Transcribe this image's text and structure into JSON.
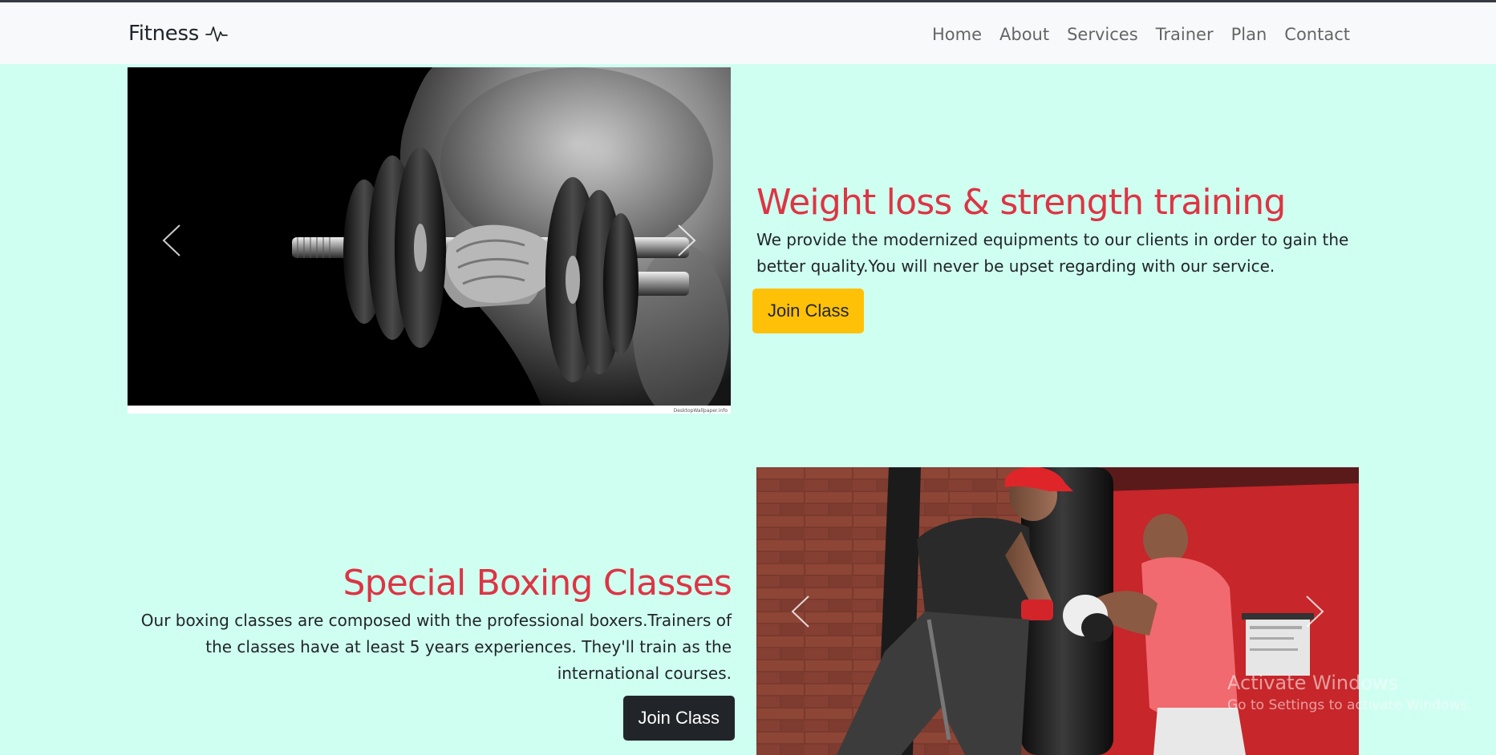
{
  "navbar": {
    "brand": "Fitness",
    "links": [
      "Home",
      "About",
      "Services",
      "Trainer",
      "Plan",
      "Contact"
    ]
  },
  "section1": {
    "heading": "Weight loss & strength training",
    "text": "We provide the modernized equipments to our clients in order to gain the better quality.You will never be upset regarding with our service.",
    "button": "Join Class",
    "image_credit": "DesktopWallpaper.info"
  },
  "section2": {
    "heading": "Special Boxing Classes",
    "text": "Our boxing classes are composed with the professional boxers.Trainers of the classes have at least 5 years experiences. They'll train as the international courses.",
    "button": "Join Class"
  },
  "watermark": {
    "title": "Activate Windows",
    "subtitle": "Go to Settings to activate Windows."
  },
  "colors": {
    "page_bg": "#cffff0",
    "navbar_bg": "#f8f9fa",
    "heading": "#dc3545",
    "btn_warning": "#ffc107",
    "btn_dark": "#212529"
  },
  "icons": {
    "brand": "activity-pulse-icon",
    "prev": "chevron-left-icon",
    "next": "chevron-right-icon"
  }
}
